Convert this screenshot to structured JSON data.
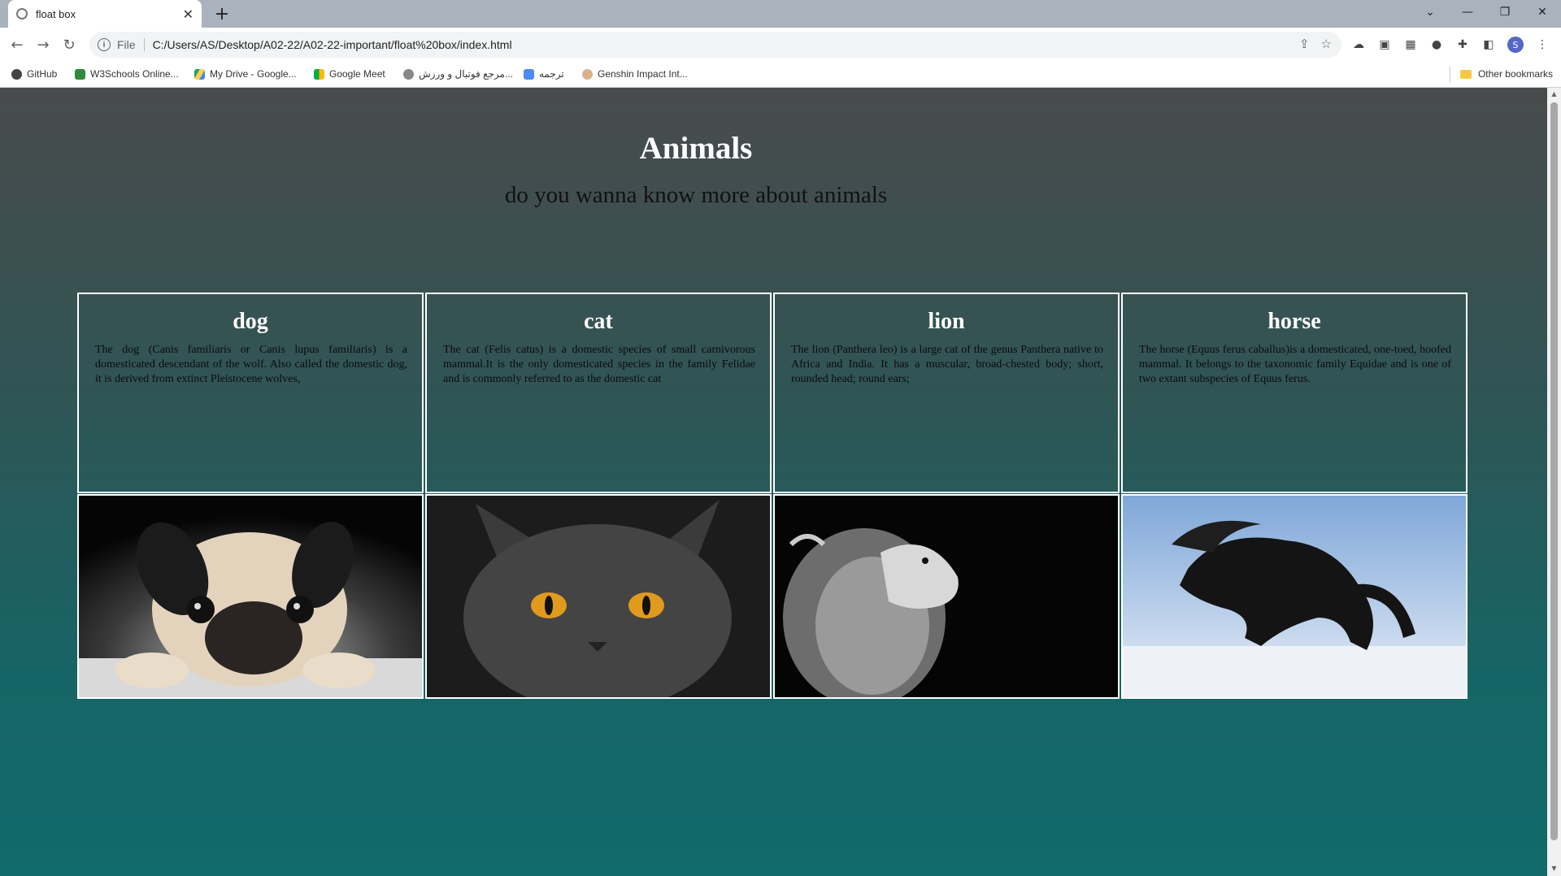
{
  "browser": {
    "tab_title": "float box",
    "new_tab": "+",
    "url_scheme": "File",
    "url": "C:/Users/AS/Desktop/A02-22/A02-22-important/float%20box/index.html",
    "profile_initial": "S",
    "bookmarks": [
      {
        "label": "GitHub",
        "icon": "github-icon"
      },
      {
        "label": "W3Schools Online...",
        "icon": "w3schools-icon"
      },
      {
        "label": "My Drive - Google...",
        "icon": "google-drive-icon"
      },
      {
        "label": "Google Meet",
        "icon": "google-meet-icon"
      },
      {
        "label": "مرجع فوتبال و ورزش...",
        "icon": "football-site-icon"
      },
      {
        "label": "ترجمه",
        "icon": "translate-icon"
      },
      {
        "label": "Genshin Impact Int...",
        "icon": "genshin-icon"
      }
    ],
    "other_bookmarks": "Other bookmarks"
  },
  "page": {
    "title": "Animals",
    "subtitle": "do you wanna know more about animals",
    "cards": [
      {
        "name": "dog",
        "text": "The dog (Canis familiaris or Canis lupus familiaris) is a domesticated descendant of the wolf. Also called the domestic dog, it is derived from extinct Pleistocene wolves,",
        "image": "pug-photo"
      },
      {
        "name": "cat",
        "text": "The cat (Felis catus) is a domestic species of small carnivorous mammal.It is the only domesticated species in the family Felidae and is commonly referred to as the domestic cat",
        "image": "grey-cat-photo"
      },
      {
        "name": "lion",
        "text": "The lion (Panthera leo) is a large cat of the genus Panthera native to Africa and India. It has a muscular, broad-chested body; short, rounded head; round ears;",
        "image": "lion-photo"
      },
      {
        "name": "horse",
        "text": "The horse (Equus ferus caballus)is a domesticated, one-toed, hoofed mammal. It belongs to the taxonomic family Equidae and is one of two extant subspecies of Equus ferus.",
        "image": "black-horse-photo"
      }
    ]
  },
  "colors": {
    "page_top": "#494b4c",
    "page_bottom": "#116a6b",
    "card_border": "#ffffff"
  }
}
